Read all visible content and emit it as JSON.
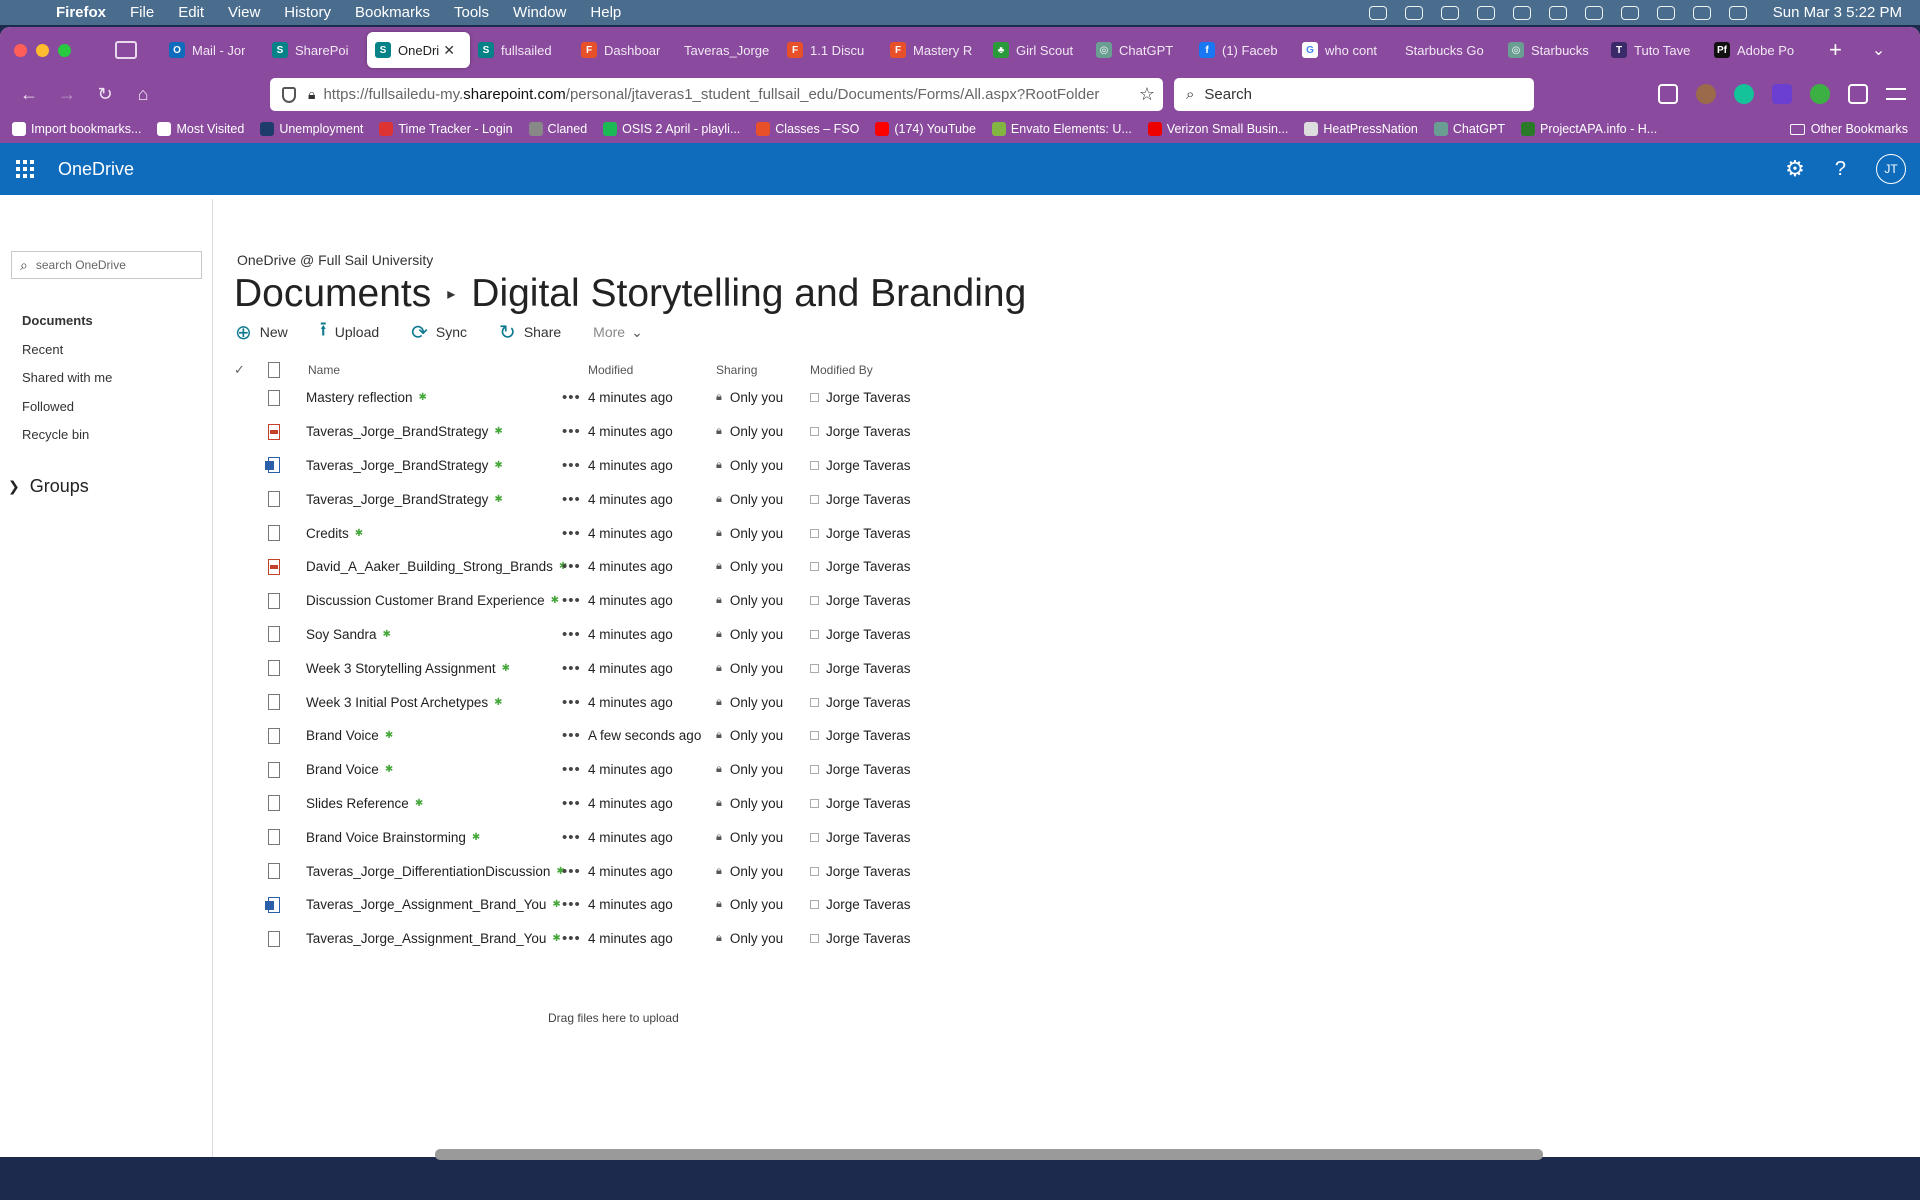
{
  "menubar": {
    "items": [
      "Firefox",
      "File",
      "Edit",
      "View",
      "History",
      "Bookmarks",
      "Tools",
      "Window",
      "Help"
    ],
    "clock": "Sun Mar 3  5:22 PM"
  },
  "tabs": [
    {
      "label": "Mail - Jor",
      "color": "#0f6cbd",
      "glyph": "O"
    },
    {
      "label": "SharePoi",
      "color": "#038387",
      "glyph": "S"
    },
    {
      "label": "OneDri",
      "color": "#038387",
      "glyph": "S",
      "active": true
    },
    {
      "label": "fullsailed",
      "color": "#038387",
      "glyph": "S"
    },
    {
      "label": "Dashboar",
      "color": "#e8502a",
      "glyph": "F"
    },
    {
      "label": "Taveras_Jorge",
      "color": "",
      "glyph": ""
    },
    {
      "label": "1.1 Discu",
      "color": "#e8502a",
      "glyph": "F"
    },
    {
      "label": "Mastery R",
      "color": "#e8502a",
      "glyph": "F"
    },
    {
      "label": "Girl Scout",
      "color": "#2b9a3a",
      "glyph": "♣"
    },
    {
      "label": "ChatGPT",
      "color": "#6a9e92",
      "glyph": "◎"
    },
    {
      "label": "(1) Faceb",
      "color": "#1877f2",
      "glyph": "f"
    },
    {
      "label": "who cont",
      "color": "#ffffff",
      "glyph": "G"
    },
    {
      "label": "Starbucks Go",
      "color": "",
      "glyph": ""
    },
    {
      "label": "Starbucks",
      "color": "#6a9e92",
      "glyph": "◎"
    },
    {
      "label": "Tuto Tave",
      "color": "#3a2a6a",
      "glyph": "T"
    },
    {
      "label": "Adobe Po",
      "color": "#111111",
      "glyph": "Pf"
    }
  ],
  "address": {
    "prefix": "https://fullsailedu-my.",
    "domain": "sharepoint.com",
    "suffix": "/personal/jtaveras1_student_fullsail_edu/Documents/Forms/All.aspx?RootFolder",
    "search_placeholder": "Search"
  },
  "bookmarks": [
    {
      "label": "Import bookmarks...",
      "color": "#ffffff"
    },
    {
      "label": "Most Visited",
      "color": "#ffffff"
    },
    {
      "label": "Unemployment",
      "color": "#1d3b6b"
    },
    {
      "label": "Time Tracker - Login",
      "color": "#d33"
    },
    {
      "label": "Claned",
      "color": "#888"
    },
    {
      "label": "OSIS 2 April - playli...",
      "color": "#1db954"
    },
    {
      "label": "Classes – FSO",
      "color": "#e8502a"
    },
    {
      "label": "(174) YouTube",
      "color": "#f00"
    },
    {
      "label": "Envato Elements: U...",
      "color": "#82b541"
    },
    {
      "label": "Verizon Small Busin...",
      "color": "#e00"
    },
    {
      "label": "HeatPressNation",
      "color": "#ddd"
    },
    {
      "label": "ChatGPT",
      "color": "#6a9e92"
    },
    {
      "label": "ProjectAPA.info - H...",
      "color": "#2a7a2a"
    }
  ],
  "bookmarks_other": "Other Bookmarks",
  "onedrive": {
    "brand": "OneDrive",
    "avatar": "JT",
    "search_placeholder": "search OneDrive",
    "nav": [
      "Documents",
      "Recent",
      "Shared with me",
      "Followed",
      "Recycle bin"
    ],
    "groups": "Groups",
    "org": "OneDrive @ Full Sail University",
    "title_root": "Documents",
    "title_folder": "Digital Storytelling and Branding",
    "commands": {
      "new": "New",
      "upload": "Upload",
      "sync": "Sync",
      "share": "Share",
      "more": "More"
    },
    "columns": {
      "name": "Name",
      "modified": "Modified",
      "sharing": "Sharing",
      "modified_by": "Modified By"
    },
    "files": [
      {
        "name": "Mastery reflection",
        "type": "generic",
        "modified": "4 minutes ago",
        "sharing": "Only you",
        "by": "Jorge Taveras"
      },
      {
        "name": "Taveras_Jorge_BrandStrategy",
        "type": "pdf",
        "modified": "4 minutes ago",
        "sharing": "Only you",
        "by": "Jorge Taveras"
      },
      {
        "name": "Taveras_Jorge_BrandStrategy",
        "type": "word",
        "modified": "4 minutes ago",
        "sharing": "Only you",
        "by": "Jorge Taveras"
      },
      {
        "name": "Taveras_Jorge_BrandStrategy",
        "type": "generic",
        "modified": "4 minutes ago",
        "sharing": "Only you",
        "by": "Jorge Taveras"
      },
      {
        "name": "Credits",
        "type": "generic",
        "modified": "4 minutes ago",
        "sharing": "Only you",
        "by": "Jorge Taveras"
      },
      {
        "name": "David_A_Aaker_Building_Strong_Brands",
        "type": "pdf",
        "modified": "4 minutes ago",
        "sharing": "Only you",
        "by": "Jorge Taveras"
      },
      {
        "name": "Discussion Customer Brand Experience",
        "type": "generic",
        "modified": "4 minutes ago",
        "sharing": "Only you",
        "by": "Jorge Taveras"
      },
      {
        "name": "Soy Sandra",
        "type": "generic",
        "modified": "4 minutes ago",
        "sharing": "Only you",
        "by": "Jorge Taveras"
      },
      {
        "name": "Week 3 Storytelling Assignment",
        "type": "generic",
        "modified": "4 minutes ago",
        "sharing": "Only you",
        "by": "Jorge Taveras"
      },
      {
        "name": "Week 3 Initial Post Archetypes",
        "type": "generic",
        "modified": "4 minutes ago",
        "sharing": "Only you",
        "by": "Jorge Taveras"
      },
      {
        "name": "Brand Voice ",
        "type": "generic",
        "modified": "A few seconds ago",
        "sharing": "Only you",
        "by": "Jorge Taveras"
      },
      {
        "name": "Brand Voice",
        "type": "generic",
        "modified": "4 minutes ago",
        "sharing": "Only you",
        "by": "Jorge Taveras"
      },
      {
        "name": "Slides Reference",
        "type": "generic",
        "modified": "4 minutes ago",
        "sharing": "Only you",
        "by": "Jorge Taveras"
      },
      {
        "name": "Brand Voice Brainstorming",
        "type": "generic",
        "modified": "4 minutes ago",
        "sharing": "Only you",
        "by": "Jorge Taveras"
      },
      {
        "name": "Taveras_Jorge_DifferentiationDiscussion",
        "type": "generic",
        "modified": "4 minutes ago",
        "sharing": "Only you",
        "by": "Jorge Taveras"
      },
      {
        "name": "Taveras_Jorge_Assignment_Brand_You",
        "type": "word",
        "modified": "4 minutes ago",
        "sharing": "Only you",
        "by": "Jorge Taveras"
      },
      {
        "name": "Taveras_Jorge_Assignment_Brand_You",
        "type": "generic",
        "modified": "4 minutes ago",
        "sharing": "Only you",
        "by": "Jorge Taveras"
      }
    ],
    "drop_note": "Drag files here to upload"
  }
}
